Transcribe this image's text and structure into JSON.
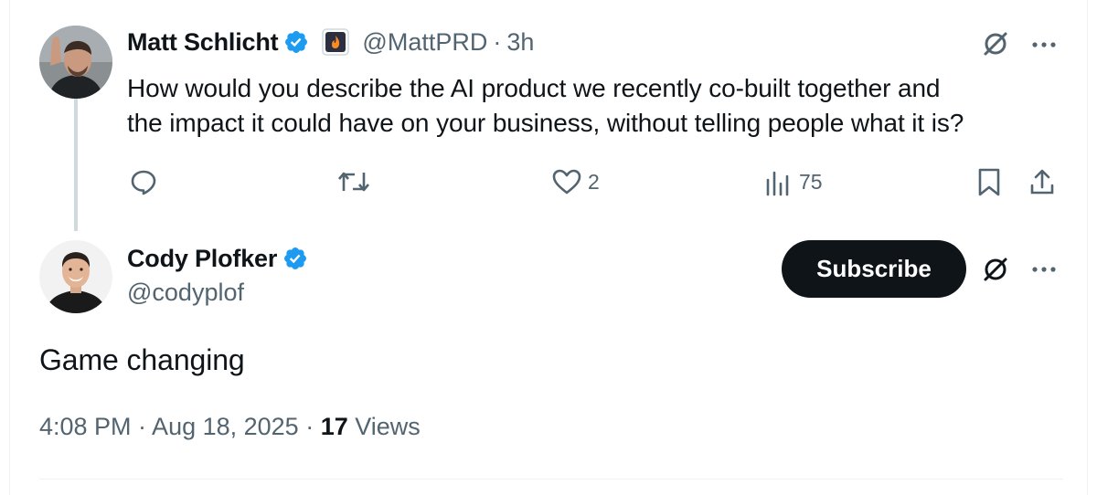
{
  "parent_tweet": {
    "author_name": "Matt Schlicht",
    "handle": "@MattPRD",
    "separator": "·",
    "time_ago": "3h",
    "text_line1": "How would you describe the AI product we recently co-built together and",
    "text_line2": "the impact it could have on your business, without telling people what it is?",
    "likes": "2",
    "views": "75",
    "icons": [
      "verified-icon",
      "affiliate-badge-icon",
      "grok-icon",
      "more-icon",
      "reply-icon",
      "retweet-icon",
      "like-icon",
      "views-icon",
      "bookmark-icon",
      "share-icon"
    ]
  },
  "main_tweet": {
    "author_name": "Cody Plofker",
    "handle": "@codyplof",
    "subscribe_label": "Subscribe",
    "text": "Game changing",
    "timestamp": "4:08 PM · Aug 18, 2025 · ",
    "view_count": "17",
    "views_label": " Views",
    "icons": [
      "verified-icon",
      "grok-icon",
      "more-icon"
    ]
  },
  "colors": {
    "verified": "#1d9bf0",
    "text": "#0f1419",
    "secondary": "#536471",
    "thread_line": "#cfd9de",
    "button": "#0f1419"
  }
}
